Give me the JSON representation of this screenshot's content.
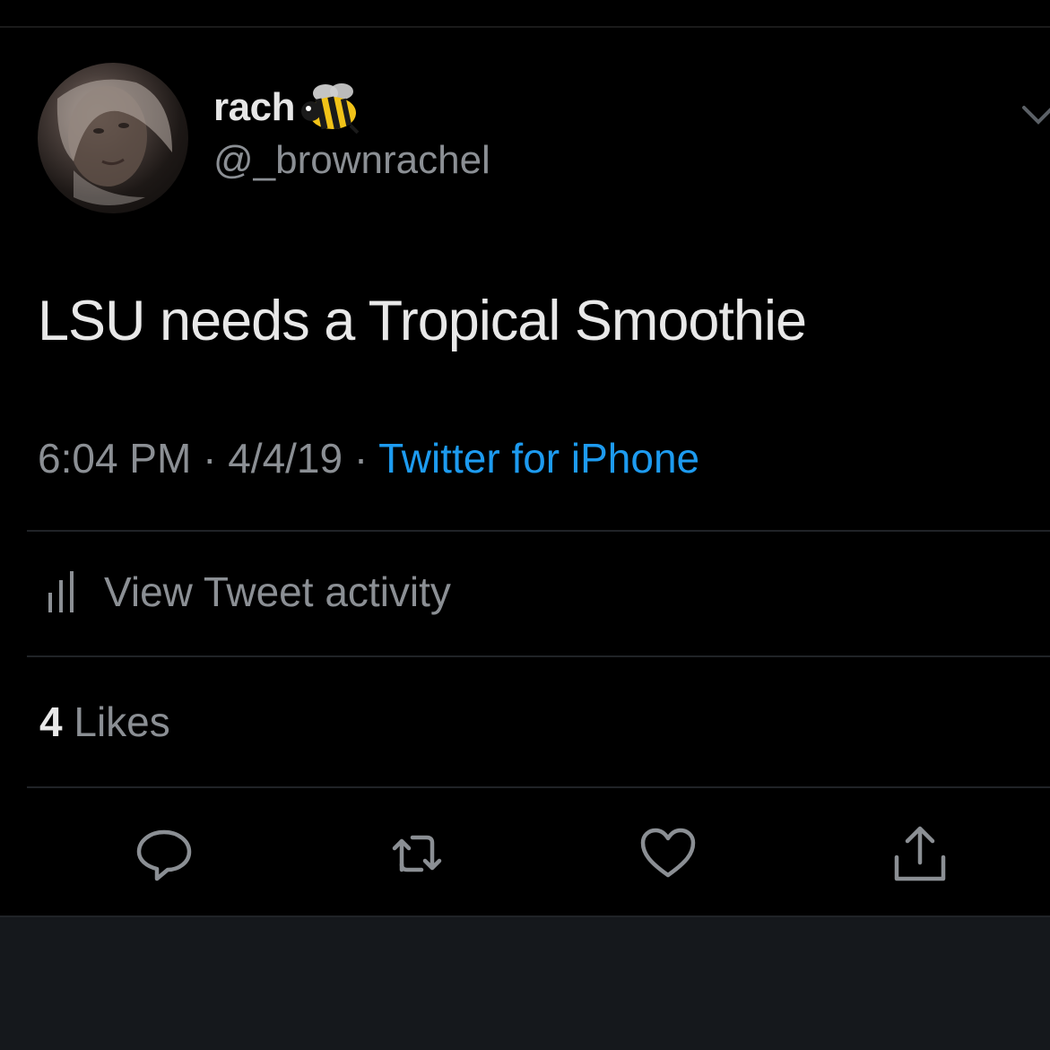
{
  "tweet": {
    "author": {
      "display_name": "rach",
      "handle": "@_brownrachel",
      "name_emoji_icon": "bee-icon",
      "avatar_icon": "user-avatar"
    },
    "text": "LSU needs a Tropical Smoothie",
    "time": "6:04 PM",
    "separator": "·",
    "date": "4/4/19",
    "source": "Twitter for iPhone",
    "menu_icon": "chevron-down-icon"
  },
  "activity": {
    "label": "View Tweet activity",
    "icon": "analytics-bars-icon"
  },
  "stats": {
    "likes_count": "4",
    "likes_label": "Likes"
  },
  "actions": [
    {
      "name": "reply",
      "icon": "reply-bubble-icon"
    },
    {
      "name": "retweet",
      "icon": "retweet-icon"
    },
    {
      "name": "like",
      "icon": "heart-icon"
    },
    {
      "name": "share",
      "icon": "share-upload-icon"
    }
  ],
  "colors": {
    "background": "#000000",
    "primary_text": "#e8e8e8",
    "secondary_text": "#8b8f94",
    "link": "#1d9bf0",
    "divider": "#202327",
    "bottom_panel": "#15181c"
  }
}
